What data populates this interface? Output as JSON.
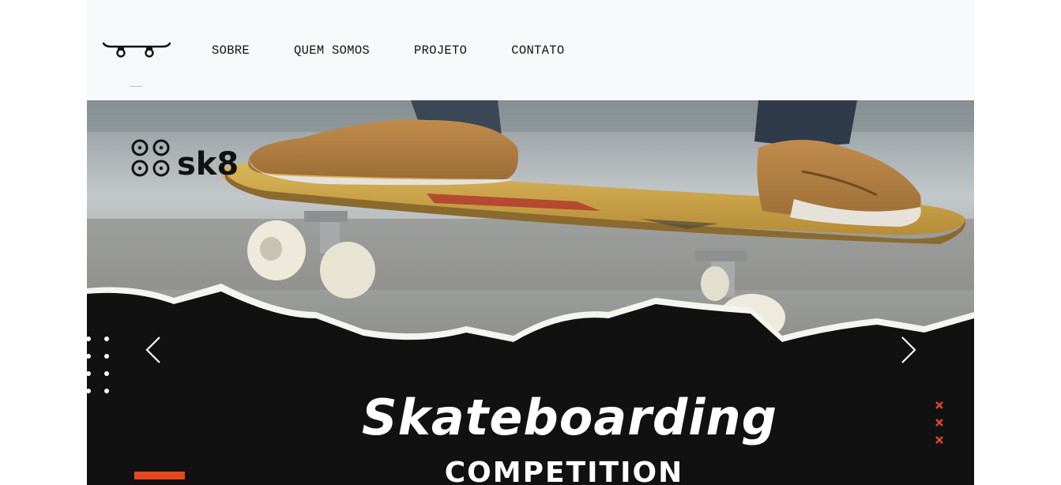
{
  "nav": {
    "logo_icon": "skateboard-icon",
    "items": [
      {
        "label": "SOBRE"
      },
      {
        "label": "QUEM SOMOS"
      },
      {
        "label": "PROJETO"
      },
      {
        "label": "CONTATO"
      }
    ]
  },
  "hero": {
    "brand": "sk8",
    "headline": "Skateboarding",
    "subheadline": "COMPETITION",
    "prev_icon": "chevron-left-icon",
    "next_icon": "chevron-right-icon",
    "accent_color": "#e8461e"
  }
}
